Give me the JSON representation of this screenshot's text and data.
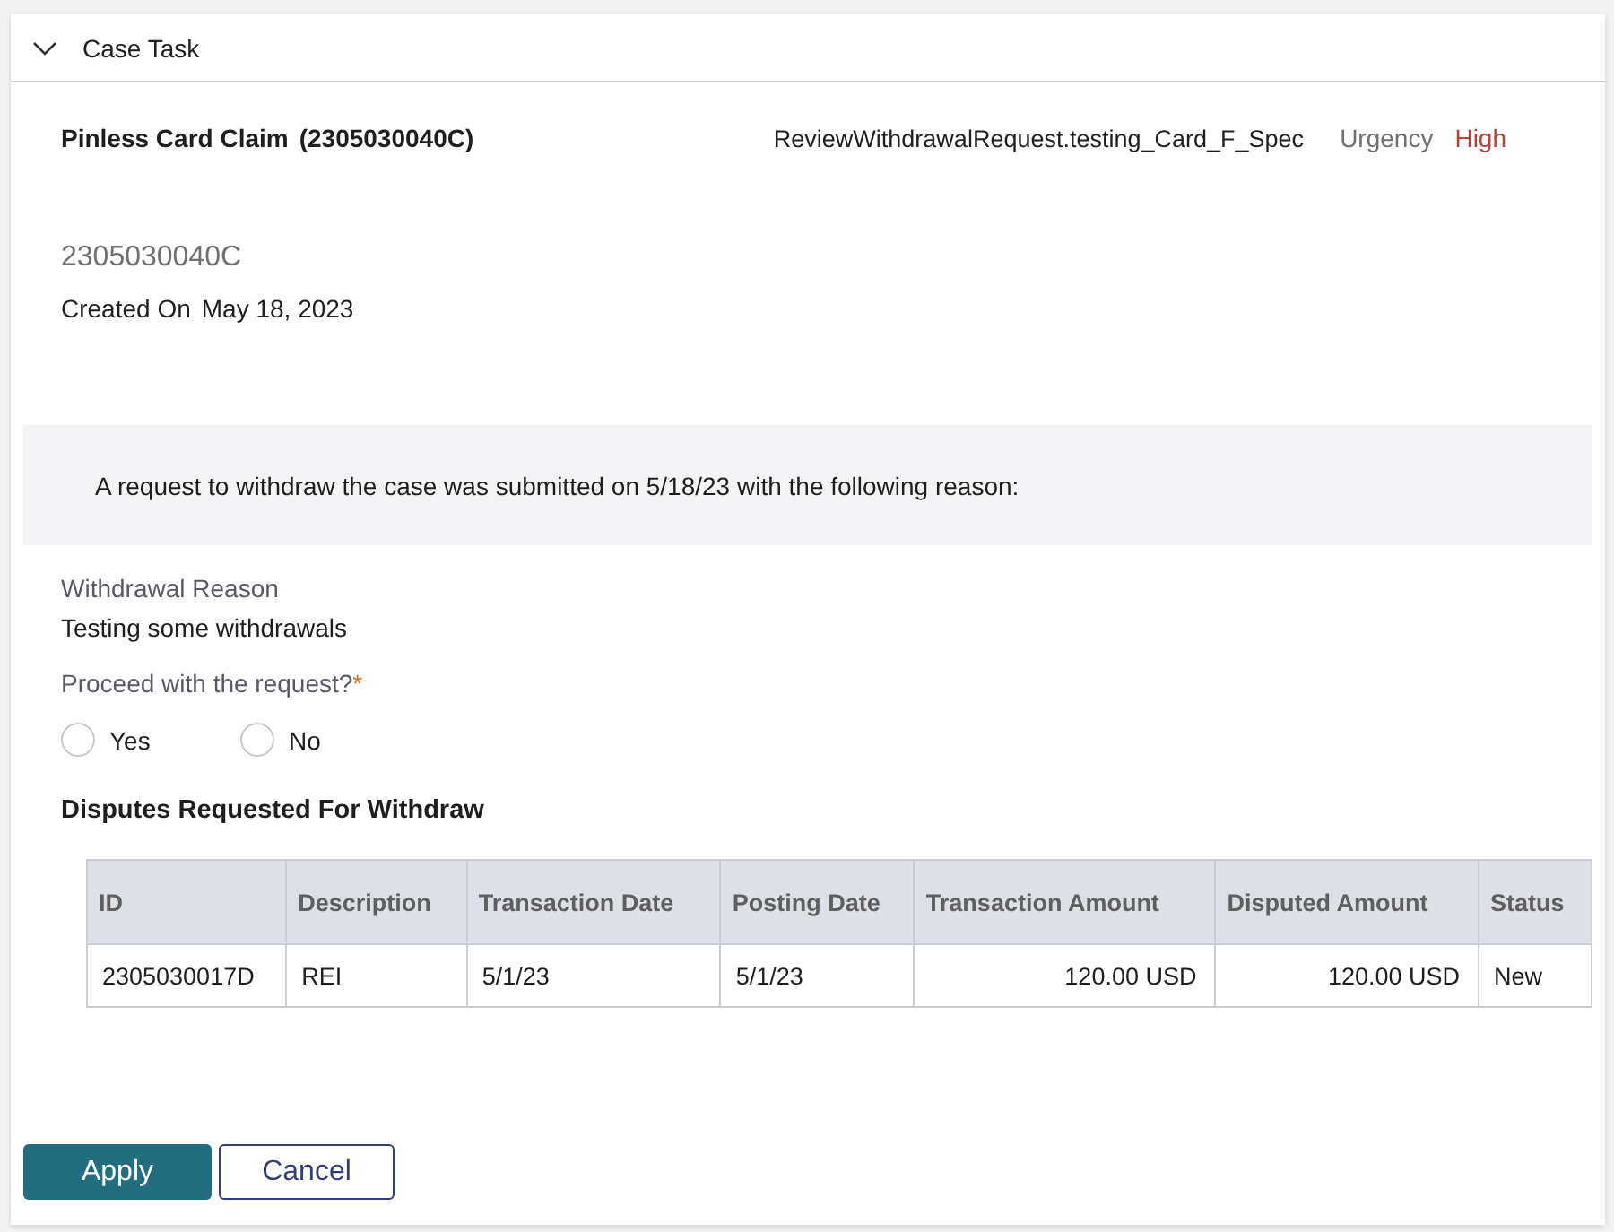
{
  "section": {
    "title": "Case Task",
    "expanded": true
  },
  "case": {
    "title": "Pinless Card Claim",
    "case_id": "(2305030040C)",
    "task": "ReviewWithdrawalRequest.testing_Card_F_Spec",
    "urgency_label": "Urgency",
    "urgency_value": "High"
  },
  "summary": {
    "id": "2305030040C",
    "created_label": "Created On",
    "created_value": "May 18, 2023"
  },
  "notice": "A request to withdraw the case was submitted on 5/18/23 with the following reason:",
  "reason": {
    "label": "Withdrawal Reason",
    "value": "Testing some withdrawals"
  },
  "question": {
    "label": "Proceed with the request?",
    "required_mark": "*",
    "options": [
      {
        "label": "Yes",
        "selected": false
      },
      {
        "label": "No",
        "selected": false
      }
    ]
  },
  "disputes": {
    "title": "Disputes Requested For Withdraw",
    "columns": [
      {
        "label": "ID",
        "kind": "text"
      },
      {
        "label": "Description",
        "kind": "text"
      },
      {
        "label": "Transaction Date",
        "kind": "text"
      },
      {
        "label": "Posting Date",
        "kind": "text"
      },
      {
        "label": "Transaction Amount",
        "kind": "amount"
      },
      {
        "label": "Disputed Amount",
        "kind": "amount"
      },
      {
        "label": "Status",
        "kind": "text"
      }
    ],
    "rows": [
      [
        "2305030017D",
        "REI",
        "5/1/23",
        "5/1/23",
        "120.00 USD",
        "120.00 USD",
        "New"
      ]
    ]
  },
  "buttons": [
    {
      "label": "Apply",
      "kind": "primary"
    },
    {
      "label": "Cancel",
      "kind": "secondary"
    }
  ]
}
